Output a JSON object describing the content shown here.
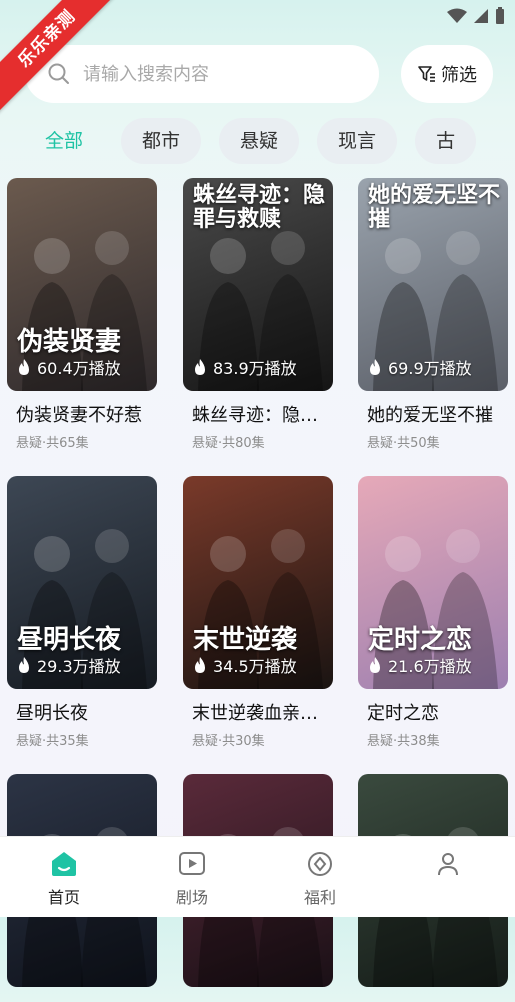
{
  "watermark": "乐乐亲测",
  "search": {
    "placeholder": "请输入搜索内容"
  },
  "filter_label": "筛选",
  "tabs": [
    {
      "label": "全部",
      "active": true
    },
    {
      "label": "都市",
      "active": false
    },
    {
      "label": "悬疑",
      "active": false
    },
    {
      "label": "现言",
      "active": false
    },
    {
      "label": "古",
      "active": false
    }
  ],
  "dramas": [
    {
      "title": "伪装贤妻不好惹",
      "poster_text": "伪装贤妻",
      "plays": "60.4万播放",
      "meta": "悬疑·共65集",
      "palette": [
        "#6b5a4e",
        "#2f2a2c"
      ]
    },
    {
      "title": "蛛丝寻迹：隐…",
      "poster_text": "蛛丝寻迹：隐罪与救赎",
      "plays": "83.9万播放",
      "meta": "悬疑·共80集",
      "palette": [
        "#4a4a4a",
        "#151515"
      ]
    },
    {
      "title": "她的爱无坚不摧",
      "poster_text": "她的爱无坚不摧",
      "plays": "69.9万播放",
      "meta": "悬疑·共50集",
      "palette": [
        "#9aa3ad",
        "#5b5f68"
      ]
    },
    {
      "title": "昼明长夜",
      "poster_text": "昼明长夜",
      "plays": "29.3万播放",
      "meta": "悬疑·共35集",
      "palette": [
        "#3d4754",
        "#161b22"
      ]
    },
    {
      "title": "末世逆袭血亲…",
      "poster_text": "末世逆袭",
      "plays": "34.5万播放",
      "meta": "悬疑·共30集",
      "palette": [
        "#7a3a2a",
        "#1a1412"
      ]
    },
    {
      "title": "定时之恋",
      "poster_text": "定时之恋",
      "plays": "21.6万播放",
      "meta": "悬疑·共38集",
      "palette": [
        "#e6a9b8",
        "#9c7fb0"
      ]
    },
    {
      "title": "",
      "poster_text": "",
      "plays": "",
      "meta": "",
      "palette": [
        "#2c3445",
        "#0f131c"
      ]
    },
    {
      "title": "",
      "poster_text": "",
      "plays": "",
      "meta": "",
      "palette": [
        "#5a2a3a",
        "#1a1016"
      ]
    },
    {
      "title": "",
      "poster_text": "",
      "plays": "",
      "meta": "",
      "palette": [
        "#3a4a3e",
        "#151c18"
      ]
    }
  ],
  "bottom_nav": [
    {
      "label": "首页",
      "icon": "home-icon",
      "active": true
    },
    {
      "label": "剧场",
      "icon": "play-box-icon",
      "active": false
    },
    {
      "label": "福利",
      "icon": "gift-icon",
      "active": false
    },
    {
      "label": "",
      "icon": "profile-icon",
      "active": false
    }
  ],
  "accent_color": "#1fc3a4"
}
